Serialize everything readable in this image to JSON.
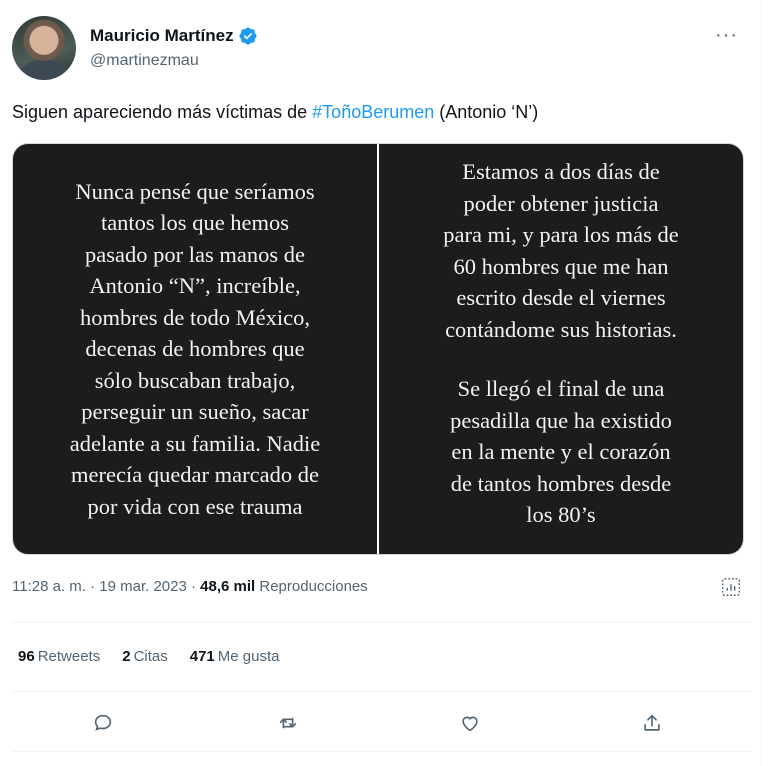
{
  "author": {
    "name": "Mauricio Martínez",
    "handle": "@martinezmau"
  },
  "tweet": {
    "text_before": "Siguen apareciendo más víctimas de ",
    "hashtag": "#ToñoBerumen",
    "text_after": " (Antonio ‘N’)"
  },
  "media": {
    "left_panel_text": "Nunca pensé que seríamos\ntantos los que hemos\npasado por las manos de\nAntonio “N”, increíble,\nhombres de todo México,\ndecenas de hombres que\nsólo buscaban trabajo,\nperseguir un sueño, sacar\nadelante a su familia. Nadie\nmerecía quedar marcado de\npor vida con ese trauma",
    "right_panel_text_1": "Estamos a dos días de\npoder obtener justicia\npara mi, y para los más de\n60 hombres que me han\nescrito desde el viernes\ncontándome sus historias.",
    "right_panel_text_2": "Se llegó el final de una\npesadilla que ha existido\nen la mente y el corazón\nde tantos hombres desde\nlos 80’s"
  },
  "meta": {
    "timestamp": "11:28 a. m. · 19 mar. 2023 · ",
    "views_count": "48,6 mil",
    "views_label": " Reproducciones"
  },
  "stats": {
    "retweets_count": "96",
    "retweets_label": "Retweets",
    "quotes_count": "2",
    "quotes_label": "Citas",
    "likes_count": "471",
    "likes_label": "Me gusta"
  },
  "icons": {
    "verified": "verified-badge-icon",
    "more": "more-icon",
    "analytics": "analytics-icon",
    "reply": "reply-icon",
    "retweet": "retweet-icon",
    "like": "like-icon",
    "share": "share-icon"
  },
  "colors": {
    "accent": "#1d9bf0",
    "text_primary": "#0f1419",
    "text_secondary": "#536471",
    "panel_bg": "#1c1c1c"
  }
}
